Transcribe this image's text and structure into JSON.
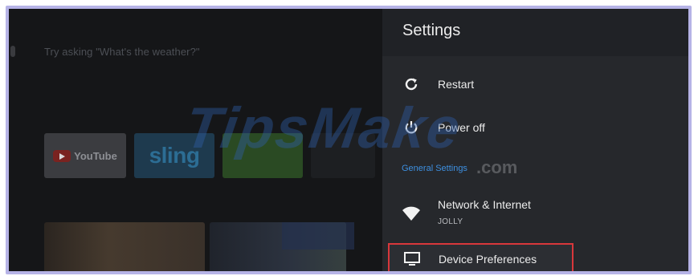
{
  "home": {
    "voice_prompt": "Try asking \"What's the weather?\"",
    "apps": [
      {
        "label": "YouTube",
        "icon": "youtube-icon"
      },
      {
        "label": "sling",
        "icon": "sling-icon"
      }
    ]
  },
  "settings_panel": {
    "title": "Settings",
    "items": [
      {
        "label": "Restart",
        "icon": "restart-icon"
      },
      {
        "label": "Power off",
        "icon": "power-icon"
      }
    ],
    "section_title": "General Settings",
    "network": {
      "label": "Network & Internet",
      "sublabel": "JOLLY",
      "icon": "wifi-icon"
    },
    "device_preferences": {
      "label": "Device Preferences",
      "icon": "tv-icon",
      "highlight_color": "#d8373b"
    }
  },
  "watermark": {
    "text": "TipsMake",
    "suffix": ".com"
  }
}
